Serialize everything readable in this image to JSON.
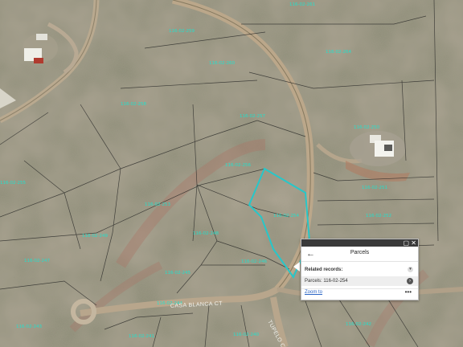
{
  "map": {
    "roads": {
      "casablanca": "CASA BLANCA CT",
      "south": "TUPELO CT"
    },
    "parcel_labels": [
      "116-02-261",
      "116-02-259",
      "116-02-260",
      "116-02-264",
      "116-02-258",
      "116-02-257",
      "116-02-250",
      "116-02-256",
      "116-02-255",
      "116-02-253",
      "116-02-251",
      "116-02-254",
      "116-02-252",
      "116-02-249",
      "116-02-248",
      "116-02-247",
      "116-02-246",
      "116-02-245",
      "116-02-244",
      "116-02-243",
      "116-02-242",
      "116-02-241",
      "116-02-240"
    ],
    "selection_color": "#27c7c9"
  },
  "popup": {
    "title": "Parcels",
    "back_icon": "arrow-left-icon",
    "maximize_icon": "maximize-icon",
    "close_icon": "close-icon",
    "related_label": "Related records:",
    "parcel_record": "Parcels: 116-02-254",
    "zoom_to": "Zoom to",
    "more": "•••"
  }
}
